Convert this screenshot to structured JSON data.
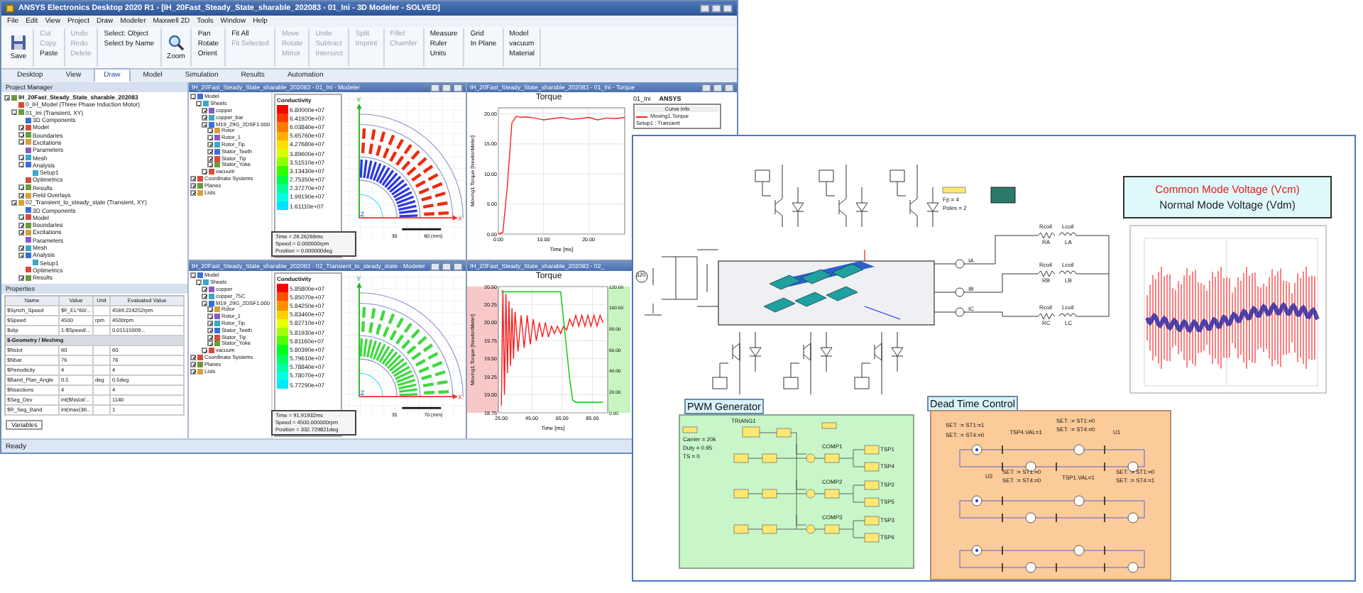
{
  "window": {
    "title": "ANSYS Electronics Desktop 2020 R1 - [IH_20Fast_Steady_State_sharable_202083 - 01_Ini - 3D Modeler - SOLVED]"
  },
  "menu": [
    "File",
    "Edit",
    "View",
    "Project",
    "Draw",
    "Modeler",
    "Maxwell 2D",
    "Tools",
    "Window",
    "Help"
  ],
  "ribbon_groups": [
    {
      "buttons": [
        {
          "label": "Save",
          "disabled": false
        }
      ]
    },
    {
      "buttons": [
        {
          "label": "Cut",
          "disabled": true
        },
        {
          "label": "Copy",
          "disabled": true
        },
        {
          "label": "Paste",
          "disabled": false
        }
      ]
    },
    {
      "buttons": [
        {
          "label": "Undo",
          "disabled": true
        },
        {
          "label": "Redo",
          "disabled": true
        },
        {
          "label": "Delete",
          "disabled": true
        }
      ]
    },
    {
      "buttons": [
        {
          "label": "Select: Object",
          "disabled": false
        },
        {
          "label": "Select by Name",
          "disabled": false
        }
      ]
    },
    {
      "buttons": [
        {
          "label": "Zoom",
          "disabled": false
        }
      ]
    },
    {
      "buttons": [
        {
          "label": "Pan",
          "disabled": false
        },
        {
          "label": "Rotate",
          "disabled": false
        },
        {
          "label": "Orient",
          "disabled": false
        }
      ]
    },
    {
      "buttons": [
        {
          "label": "Fit All",
          "disabled": false
        },
        {
          "label": "Fit Selected",
          "disabled": true
        }
      ]
    },
    {
      "buttons": [
        {
          "label": "Move",
          "disabled": true
        },
        {
          "label": "Rotate",
          "disabled": true
        },
        {
          "label": "Mirror",
          "disabled": true
        }
      ]
    },
    {
      "buttons": [
        {
          "label": "Unite",
          "disabled": true
        },
        {
          "label": "Subtract",
          "disabled": true
        },
        {
          "label": "Intersect",
          "disabled": true
        }
      ]
    },
    {
      "buttons": [
        {
          "label": "Split",
          "disabled": true
        },
        {
          "label": "Imprint",
          "disabled": true
        }
      ]
    },
    {
      "buttons": [
        {
          "label": "Fillet",
          "disabled": true
        },
        {
          "label": "Chamfer",
          "disabled": true
        }
      ]
    },
    {
      "buttons": [
        {
          "label": "Measure",
          "disabled": false
        },
        {
          "label": "Ruler",
          "disabled": false
        },
        {
          "label": "Units",
          "disabled": false
        }
      ]
    },
    {
      "buttons": [
        {
          "label": "Grid",
          "disabled": false
        },
        {
          "label": "In Plane",
          "disabled": false
        }
      ]
    },
    {
      "buttons": [
        {
          "label": "Model",
          "disabled": false
        },
        {
          "label": "vacuum",
          "disabled": false
        },
        {
          "label": "Material",
          "disabled": false
        }
      ]
    }
  ],
  "ribbon_tabs": [
    {
      "label": "Desktop",
      "selected": false
    },
    {
      "label": "View",
      "selected": false
    },
    {
      "label": "Draw",
      "selected": true
    },
    {
      "label": "Model",
      "selected": false
    },
    {
      "label": "Simulation",
      "selected": false
    },
    {
      "label": "Results",
      "selected": false
    },
    {
      "label": "Automation",
      "selected": false
    }
  ],
  "project_manager": {
    "title": "Project Manager",
    "tree": [
      {
        "label": "IH_20Fast_Steady_State_sharable_202083",
        "expanded": true,
        "children": [
          {
            "label": "0_IH_Model (Three Phase Induction Motor)"
          },
          {
            "label": "01_Ini (Transient, XY)",
            "expanded": true,
            "children": [
              {
                "label": "3D Components"
              },
              {
                "label": "Model",
                "expanded": false
              },
              {
                "label": "Boundaries",
                "expanded": false
              },
              {
                "label": "Excitations",
                "expanded": false
              },
              {
                "label": "Parameters"
              },
              {
                "label": "Mesh",
                "expanded": false
              },
              {
                "label": "Analysis",
                "expanded": true,
                "children": [
                  {
                    "label": "Setup1"
                  }
                ]
              },
              {
                "label": "Optimetrics"
              },
              {
                "label": "Results",
                "expanded": false
              },
              {
                "label": "Field Overlays",
                "expanded": false
              }
            ]
          },
          {
            "label": "02_Transient_to_steady_state (Transient, XY)",
            "expanded": true,
            "children": [
              {
                "label": "3D Components"
              },
              {
                "label": "Model",
                "expanded": false
              },
              {
                "label": "Boundaries",
                "expanded": false
              },
              {
                "label": "Excitations",
                "expanded": false
              },
              {
                "label": "Parameters"
              },
              {
                "label": "Mesh",
                "expanded": false
              },
              {
                "label": "Analysis",
                "expanded": true,
                "children": [
                  {
                    "label": "Setup1"
                  }
                ]
              },
              {
                "label": "Optimetrics"
              },
              {
                "label": "Results",
                "expanded": false
              }
            ]
          }
        ]
      }
    ]
  },
  "properties": {
    "title": "Properties",
    "columns": [
      "Name",
      "Value",
      "Unit",
      "Evaluated Value"
    ],
    "rows": [
      {
        "kind": "row",
        "cells": [
          "$Synch_Speed",
          "$F_EL*60/...",
          "",
          "4569.224252rpm"
        ]
      },
      {
        "kind": "row",
        "cells": [
          "$Speed",
          "4500",
          "rpm",
          "4500rpm"
        ]
      },
      {
        "kind": "row",
        "cells": [
          "$slip",
          "1-$Speed/...",
          "",
          "0.01515009..."
        ]
      },
      {
        "kind": "section",
        "cells": [
          "$-Geometry / Meshing"
        ]
      },
      {
        "kind": "row",
        "cells": [
          "$Nslot",
          "60",
          "",
          "60"
        ]
      },
      {
        "kind": "row",
        "cells": [
          "$Nbar",
          "76",
          "",
          "76"
        ]
      },
      {
        "kind": "row",
        "cells": [
          "$Periodicity",
          "4",
          "",
          "4"
        ]
      },
      {
        "kind": "row",
        "cells": [
          "$Band_Plan_Angle",
          "0.5",
          "deg",
          "0.5deg"
        ]
      },
      {
        "kind": "row",
        "cells": [
          "$Nsections",
          "4",
          "",
          "4"
        ]
      },
      {
        "kind": "row",
        "cells": [
          "$Seg_Dev",
          "int($Nslot/...",
          "",
          "1140"
        ]
      },
      {
        "kind": "row",
        "cells": [
          "$R_Seg_Band",
          "int(max(36...",
          "",
          "1"
        ]
      }
    ],
    "tab": "Variables"
  },
  "views": [
    {
      "kind": "modeler",
      "title": "IH_20Fast_Steady_State_sharable_202083 - 01_Ini - Modeler",
      "tree": [
        {
          "label": "Model",
          "expanded": true,
          "children": [
            {
              "label": "Sheets",
              "expanded": true,
              "children": [
                {
                  "label": "copper",
                  "expanded": false
                },
                {
                  "label": "copper_bar",
                  "expanded": false
                },
                {
                  "label": "M19_29G_2DSF1.000",
                  "expanded": true,
                  "children": [
                    {
                      "label": "Rotor",
                      "expanded": false
                    },
                    {
                      "label": "Rotor_1",
                      "expanded": false
                    },
                    {
                      "label": "Rotor_Tip",
                      "expanded": false
                    },
                    {
                      "label": "Stator_Teeth",
                      "expanded": false
                    },
                    {
                      "label": "Stator_Tip",
                      "expanded": false
                    },
                    {
                      "label": "Stator_Yoke",
                      "expanded": false
                    }
                  ]
                },
                {
                  "label": "vacuum",
                  "expanded": false
                }
              ]
            }
          ]
        },
        {
          "label": "Coordinate Systems",
          "expanded": false
        },
        {
          "label": "Planes",
          "expanded": false
        },
        {
          "label": "Lists",
          "expanded": false
        }
      ],
      "legend": {
        "title": "Conductivity",
        "levels": [
          {
            "value": "6.80000e+07",
            "color": "#ff0000"
          },
          {
            "value": "6.41920e+07",
            "color": "#ff3a00"
          },
          {
            "value": "6.03840e+07",
            "color": "#ff7a00"
          },
          {
            "value": "5.65760e+07",
            "color": "#ffb000"
          },
          {
            "value": "4.27680e+07",
            "color": "#ffe000"
          },
          {
            "value": "3.89600e+07",
            "color": "#d8ff00"
          },
          {
            "value": "3.51510e+07",
            "color": "#90ff00"
          },
          {
            "value": "3.13430e+07",
            "color": "#30ff00"
          },
          {
            "value": "2.75350e+07",
            "color": "#00ff40"
          },
          {
            "value": "2.37270e+07",
            "color": "#00ff9a"
          },
          {
            "value": "1.99190e+07",
            "color": "#00ffe0"
          },
          {
            "value": "1.61110e+07",
            "color": "#00e0ff"
          }
        ]
      },
      "axes": [
        "Y",
        "Z",
        "X"
      ],
      "scale": [
        "30",
        "60 (mm)"
      ],
      "readout": [
        "Time = 26.26266ms",
        "Speed = 0.000000rpm",
        "Position = 0.000000deg"
      ]
    },
    {
      "kind": "plot",
      "title": "IH_20Fast_Steady_State_sharable_202083 - 01_Ini - Torque",
      "plot_title": "Torque",
      "design": "01_Ini",
      "brand": "ANSYS",
      "legend": {
        "title": "Curve Info",
        "items": [
          "Setup1 : Transient"
        ]
      },
      "chart_data": {
        "type": "line",
        "grid": true,
        "xlabel": "Time [ms]",
        "ylabel": "Moving1.Torque [NewtonMeter]",
        "x": [
          0,
          1,
          2,
          3,
          4,
          5,
          6,
          8,
          10,
          12,
          14,
          16,
          18,
          20,
          22,
          24,
          26,
          28
        ],
        "series": [
          {
            "name": "Moving1.Torque",
            "color": "#ff2020",
            "values": [
              0,
              0.3,
              8,
              18.5,
              19.6,
              19.4,
              19.5,
              19.3,
              19.0,
              19.2,
              19.4,
              19.1,
              19.2,
              19.4,
              19.0,
              19.3,
              19.2,
              19.4
            ]
          }
        ],
        "xlim": [
          0,
          28
        ],
        "ylim": [
          0,
          21
        ],
        "xticks": [
          {
            "value": 0,
            "label": "0.00"
          },
          {
            "value": 10,
            "label": "10.00"
          },
          {
            "value": 20,
            "label": "20.00"
          }
        ],
        "yticks": [
          {
            "value": 0,
            "label": "0.00"
          },
          {
            "value": 5,
            "label": "5.00"
          },
          {
            "value": 10,
            "label": "10.00"
          },
          {
            "value": 15,
            "label": "15.00"
          },
          {
            "value": 20,
            "label": "20.00"
          }
        ]
      }
    },
    {
      "kind": "modeler",
      "title": "IH_20Fast_Steady_State_sharable_202083 - 02_Transient_to_steady_state - Modeler",
      "tree": [
        {
          "label": "Model",
          "expanded": true,
          "children": [
            {
              "label": "Sheets",
              "expanded": true,
              "children": [
                {
                  "label": "copper",
                  "expanded": false
                },
                {
                  "label": "copper_75C",
                  "expanded": false
                },
                {
                  "label": "M19_29G_2DSF1.000",
                  "expanded": true,
                  "children": [
                    {
                      "label": "Rotor",
                      "expanded": false
                    },
                    {
                      "label": "Rotor_1",
                      "expanded": false
                    },
                    {
                      "label": "Rotor_Tip",
                      "expanded": false
                    },
                    {
                      "label": "Stator_Teeth",
                      "expanded": false
                    },
                    {
                      "label": "Stator_Tip",
                      "expanded": false
                    },
                    {
                      "label": "Stator_Yoke",
                      "expanded": false
                    }
                  ]
                },
                {
                  "label": "vacuum",
                  "expanded": false
                }
              ]
            }
          ]
        },
        {
          "label": "Coordinate Systems",
          "expanded": false
        },
        {
          "label": "Planes",
          "expanded": false
        },
        {
          "label": "Lists",
          "expanded": false
        }
      ],
      "legend": {
        "title": "Conductivity",
        "levels": [
          {
            "value": "5.85800e+07",
            "color": "#ff0000"
          },
          {
            "value": "5.85070e+07",
            "color": "#ff5000"
          },
          {
            "value": "5.84250e+07",
            "color": "#ff9000"
          },
          {
            "value": "5.83460e+07",
            "color": "#ffd000"
          },
          {
            "value": "5.82710e+07",
            "color": "#e8ff00"
          },
          {
            "value": "5.81930e+07",
            "color": "#a0ff00"
          },
          {
            "value": "5.81160e+07",
            "color": "#50ff00"
          },
          {
            "value": "5.80390e+07",
            "color": "#00ff20"
          },
          {
            "value": "5.79610e+07",
            "color": "#00ff60"
          },
          {
            "value": "5.78840e+07",
            "color": "#00ffa0"
          },
          {
            "value": "5.78070e+07",
            "color": "#00ffe0"
          },
          {
            "value": "5.77290e+07",
            "color": "#00e8ff"
          }
        ]
      },
      "axes": [
        "Y",
        "Z",
        "X"
      ],
      "scale": [
        "35",
        "70 (mm)"
      ],
      "readout": [
        "Time = 91.91932ms",
        "Speed = 4500.000000rpm",
        "Position = 332.729821deg"
      ]
    },
    {
      "kind": "plot",
      "title": "IH_20Fast_Steady_State_sharable_202083 - 02_",
      "plot_title": "Torque",
      "chart_data": {
        "type": "line",
        "grid": true,
        "xlabel": "Time [ms]",
        "ylabel": "Moving1.Torque [NewtonMeter]",
        "x": [
          25,
          26,
          27,
          28,
          29,
          30,
          31,
          32,
          33,
          34,
          36,
          38,
          40,
          42,
          44,
          46,
          48,
          50,
          52,
          54,
          56,
          58,
          60,
          62,
          64,
          66,
          68,
          70,
          72,
          74,
          76,
          78,
          80,
          82,
          84,
          86,
          88,
          90,
          92
        ],
        "series": [
          {
            "color": "#ff1a1a",
            "values": [
              18.85,
              20.45,
              19.0,
              20.4,
              19.3,
              20.3,
              19.4,
              20.2,
              19.5,
              20.15,
              19.6,
              20.1,
              19.65,
              20.1,
              19.7,
              20.05,
              19.75,
              20.0,
              19.8,
              20.0,
              19.8,
              19.95,
              19.85,
              19.95,
              19.85,
              19.95,
              19.9,
              20.05,
              19.95,
              20.1,
              19.95,
              20.1,
              19.95,
              20.1,
              19.95,
              20.1,
              19.95,
              20.1,
              20.0
            ]
          },
          {
            "color": "#20d020",
            "axis": "y2",
            "values": [
              115,
              115,
              115,
              115,
              115,
              115,
              115,
              115,
              115,
              115,
              115,
              115,
              115,
              115,
              115,
              115,
              115,
              115,
              115,
              115,
              115,
              115,
              115,
              115,
              115,
              88,
              60,
              32,
              12,
              10,
              10,
              10,
              10,
              10,
              10,
              10,
              10,
              10,
              10
            ]
          }
        ],
        "xlim": [
          23,
          95
        ],
        "ylim": [
          18.75,
          20.5
        ],
        "y2lim": [
          0,
          120
        ],
        "xticks": [
          {
            "value": 25,
            "label": "25.00"
          },
          {
            "value": 45,
            "label": "45.00"
          },
          {
            "value": 65,
            "label": "65.00"
          },
          {
            "value": 85,
            "label": "85.00"
          }
        ],
        "yticks": [
          {
            "value": 18.75,
            "label": "18.75"
          },
          {
            "value": 19,
            "label": "19.00"
          },
          {
            "value": 19.25,
            "label": "19.25"
          },
          {
            "value": 19.5,
            "label": "19.50"
          },
          {
            "value": 19.75,
            "label": "19.75"
          },
          {
            "value": 20,
            "label": "20.00"
          },
          {
            "value": 20.25,
            "label": "20.25"
          },
          {
            "value": 20.5,
            "label": "20.50"
          }
        ],
        "y2ticks": [
          {
            "value": 0,
            "label": "0.00"
          },
          {
            "value": 20,
            "label": "20.00"
          },
          {
            "value": 40,
            "label": "40.00"
          },
          {
            "value": 60,
            "label": "60.00"
          },
          {
            "value": 80,
            "label": "80.00"
          },
          {
            "value": 100,
            "label": "100.00"
          },
          {
            "value": 120,
            "label": "120.00"
          }
        ]
      }
    }
  ],
  "status_bar": "Ready",
  "circuit": {
    "source": "320",
    "meters": [
      "IA",
      "IB",
      "IC"
    ],
    "loads": [
      {
        "r_name": "Rcoil",
        "r": "RA",
        "l_name": "Lcoil",
        "l": "LA"
      },
      {
        "r_name": "Rcoil",
        "r": "RB",
        "l_name": "Lcoil",
        "l": "LB"
      },
      {
        "r_name": "Rcoil",
        "r": "RC",
        "l_name": "Lcoil",
        "l": "LC"
      }
    ],
    "parameters": [
      "Fp = 4",
      "Poles = 2"
    ],
    "voltage_legend": [
      "Common Mode Voltage (Vcm)",
      "Normal Mode Voltage (Vdm)"
    ],
    "pwm": {
      "title": "PWM Generator",
      "carrier": "TRIANG1",
      "params": [
        "Carrier = 20k",
        "Duty = 0.95",
        "TS = 0"
      ],
      "comparators": [
        "COMP1",
        "COMP2",
        "COMP3"
      ],
      "outputs": [
        "TSP1",
        "TSP4",
        "TSP2",
        "TSP5",
        "TSP3",
        "TSP6"
      ]
    },
    "dead_time": {
      "title": "Dead Time Control",
      "labels": [
        "SET: := ST1:=1",
        "SET: := ST4:=0",
        "TSP4.VAL=1",
        "SET: := ST1:=0",
        "SET: := ST4:=0",
        "U1",
        "U2",
        "SET: := ST1:=0",
        "SET: := ST4:=0",
        "TSP1.VAL=1",
        "SET: := ST1:=0",
        "SET: := ST4:=1"
      ]
    }
  }
}
